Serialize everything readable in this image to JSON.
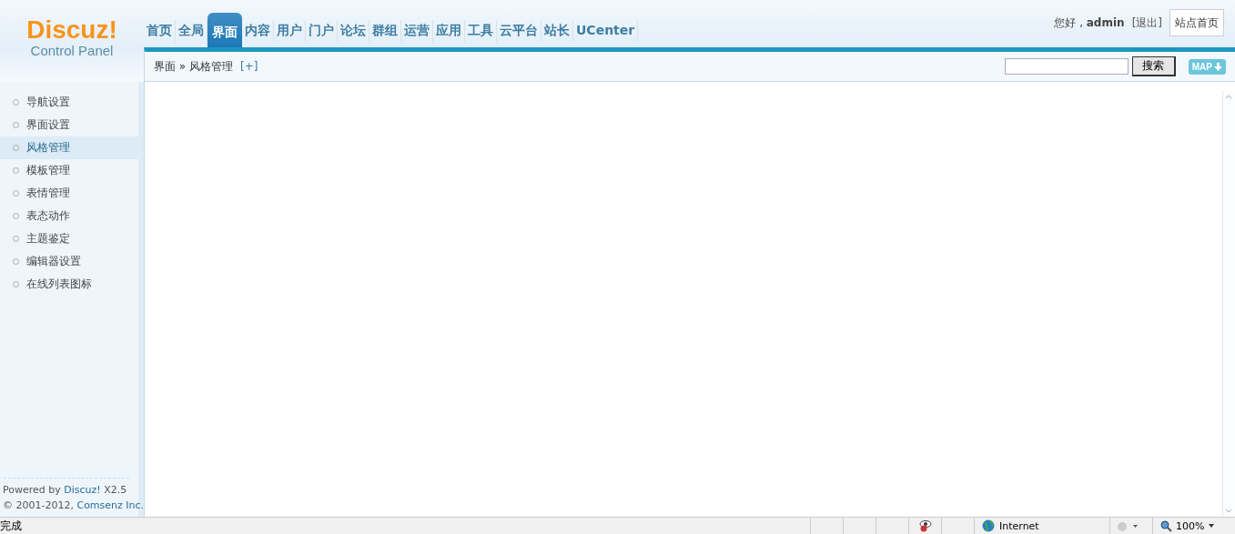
{
  "logo": {
    "title": "Discuz!",
    "subtitle": "Control Panel"
  },
  "nav": [
    {
      "label": "首页",
      "selected": false
    },
    {
      "label": "全局",
      "selected": false
    },
    {
      "label": "界面",
      "selected": true
    },
    {
      "label": "内容",
      "selected": false
    },
    {
      "label": "用户",
      "selected": false
    },
    {
      "label": "门户",
      "selected": false
    },
    {
      "label": "论坛",
      "selected": false
    },
    {
      "label": "群组",
      "selected": false
    },
    {
      "label": "运营",
      "selected": false
    },
    {
      "label": "应用",
      "selected": false
    },
    {
      "label": "工具",
      "selected": false
    },
    {
      "label": "云平台",
      "selected": false
    },
    {
      "label": "站长",
      "selected": false
    },
    {
      "label": "UCenter",
      "selected": false
    }
  ],
  "user": {
    "greeting": "您好 ,",
    "name": "admin",
    "logout": "[退出]",
    "site_home": "站点首页"
  },
  "breadcrumb": {
    "path": "界面 » 风格管理",
    "add": "[+]"
  },
  "search": {
    "button": "搜索"
  },
  "map_button": "MAP",
  "sidebar": {
    "items": [
      {
        "label": "导航设置",
        "selected": false
      },
      {
        "label": "界面设置",
        "selected": false
      },
      {
        "label": "风格管理",
        "selected": true
      },
      {
        "label": "模板管理",
        "selected": false
      },
      {
        "label": "表情管理",
        "selected": false
      },
      {
        "label": "表态动作",
        "selected": false
      },
      {
        "label": "主题鉴定",
        "selected": false
      },
      {
        "label": "编辑器设置",
        "selected": false
      },
      {
        "label": "在线列表图标",
        "selected": false
      }
    ]
  },
  "footer": {
    "powered": "Powered by",
    "product": "Discuz!",
    "version": "X2.5",
    "copyright": "© 2001-2012,",
    "company": "Comsenz Inc."
  },
  "status_bar": {
    "text": "完成",
    "zone": "Internet",
    "zoom": "100%"
  }
}
